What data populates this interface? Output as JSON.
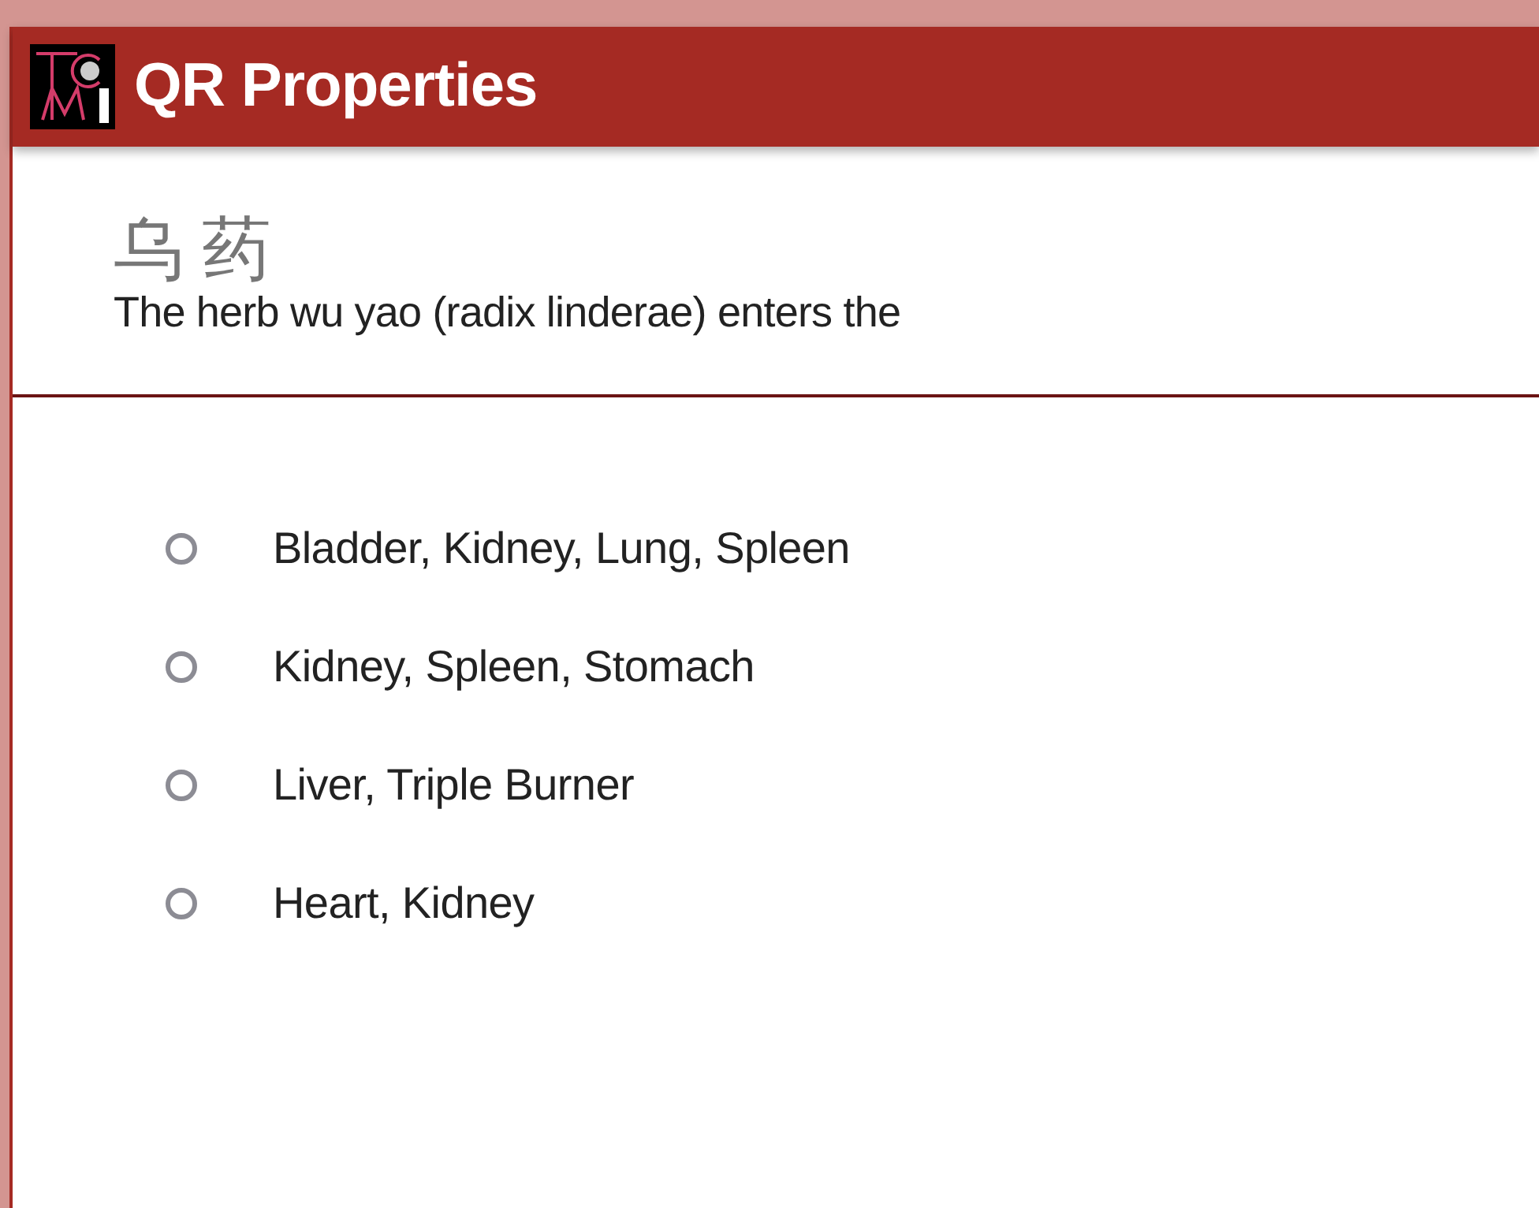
{
  "window": {
    "title": "QR Properties"
  },
  "question": {
    "chinese": "乌药",
    "text": "The herb wu yao (radix linderae) enters the"
  },
  "options": [
    {
      "label": "Bladder, Kidney, Lung, Spleen",
      "selected": false
    },
    {
      "label": "Kidney, Spleen, Stomach",
      "selected": false
    },
    {
      "label": "Liver, Triple Burner",
      "selected": false
    },
    {
      "label": "Heart, Kidney",
      "selected": false
    }
  ]
}
